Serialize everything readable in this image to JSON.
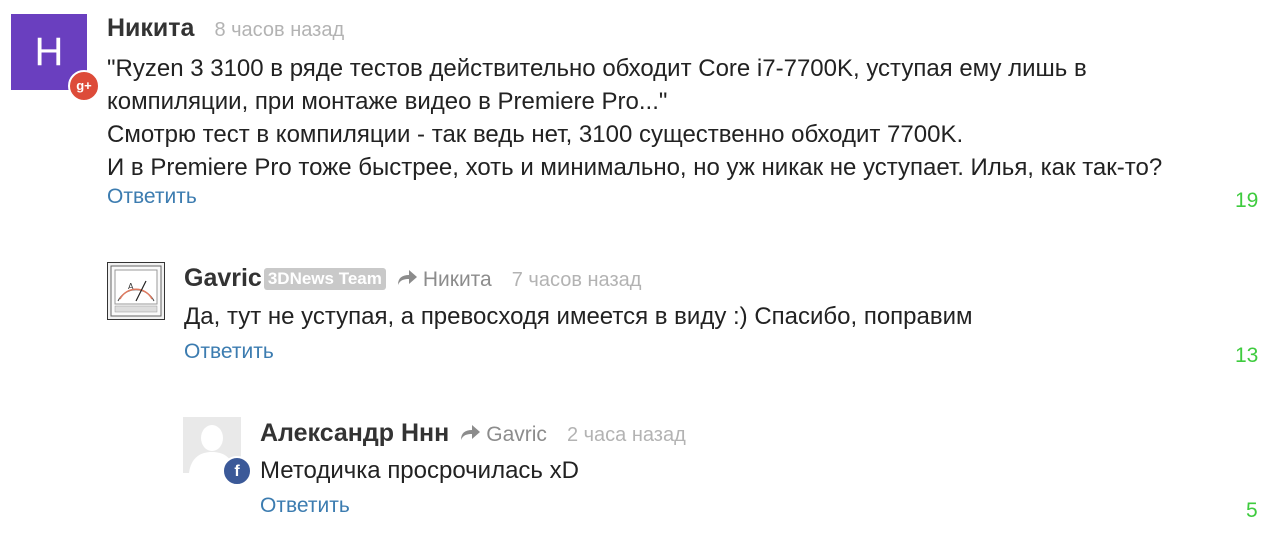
{
  "comments": [
    {
      "author": "Никита",
      "avatar_letter": "H",
      "avatar_color": "#6a3fbf",
      "social": "google-plus-icon",
      "social_label": "g+",
      "time": "8 часов назад",
      "text_lines": [
        "\"Ryzen 3 3100 в ряде тестов действительно обходит Core i7-7700K, уступая ему лишь в",
        "компиляции, при монтаже видео в Premiere Pro...\"",
        "Смотрю тест в компиляции - так ведь нет, 3100 существенно обходит 7700K.",
        "И в Premiere Pro тоже быстрее, хоть и минимально, но уж никак не уступает. Илья, как так-то?"
      ],
      "reply_label": "Ответить",
      "score": "19"
    },
    {
      "author": "Gavric",
      "badge": "3DNews Team",
      "reply_to": "Никита",
      "time": "7 часов назад",
      "text_lines": [
        "Да, тут не уступая, а превосходя имеется в виду :) Спасибо, поправим"
      ],
      "reply_label": "Ответить",
      "score": "13"
    },
    {
      "author": "Александр Ннн",
      "reply_to": "Gavric",
      "social": "facebook-icon",
      "social_label": "f",
      "time": "2 часа назад",
      "text_lines": [
        "Методичка просрочилась xD"
      ],
      "reply_label": "Ответить",
      "score": "5"
    }
  ],
  "colors": {
    "link": "#3c7cb0",
    "score": "#3ecb3e",
    "google_red": "#dd4b39",
    "facebook_blue": "#3b5998"
  }
}
